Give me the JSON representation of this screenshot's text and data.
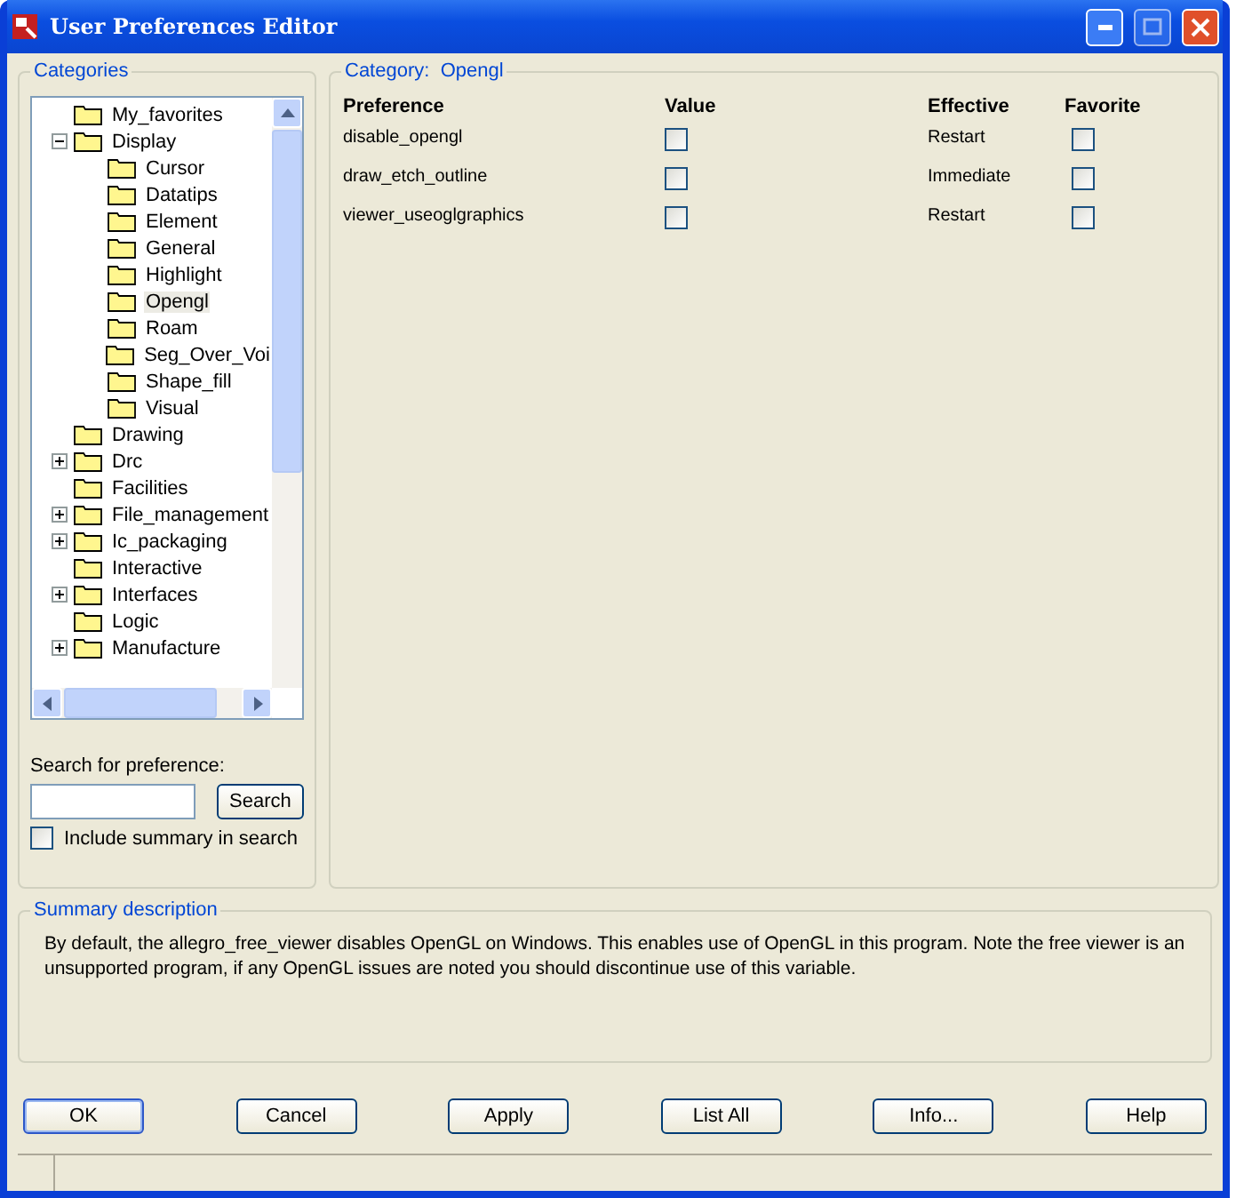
{
  "window": {
    "title": "User Preferences Editor"
  },
  "categories": {
    "title": "Categories",
    "tree": [
      {
        "label": "My_favorites",
        "selected": false
      },
      {
        "label": "Display",
        "expanded": true,
        "selected": false,
        "children": [
          {
            "label": "Cursor",
            "selected": false
          },
          {
            "label": "Datatips",
            "selected": false
          },
          {
            "label": "Element",
            "selected": false
          },
          {
            "label": "General",
            "selected": false
          },
          {
            "label": "Highlight",
            "selected": false
          },
          {
            "label": "Opengl",
            "selected": true
          },
          {
            "label": "Roam",
            "selected": false
          },
          {
            "label": "Seg_Over_Voi",
            "selected": false
          },
          {
            "label": "Shape_fill",
            "selected": false
          },
          {
            "label": "Visual",
            "selected": false
          }
        ]
      },
      {
        "label": "Drawing",
        "selected": false
      },
      {
        "label": "Drc",
        "expanded": false,
        "selected": false
      },
      {
        "label": "Facilities",
        "selected": false
      },
      {
        "label": "File_management",
        "expanded": false,
        "selected": false
      },
      {
        "label": "Ic_packaging",
        "expanded": false,
        "selected": false
      },
      {
        "label": "Interactive",
        "selected": false
      },
      {
        "label": "Interfaces",
        "expanded": false,
        "selected": false
      },
      {
        "label": "Logic",
        "selected": false
      },
      {
        "label": "Manufacture",
        "expanded": false,
        "selected": false
      }
    ],
    "search_label": "Search for preference:",
    "search_button": "Search",
    "include_summary": {
      "label": "Include summary in search",
      "checked": false
    }
  },
  "category": {
    "title_label": "Category:",
    "title_value": "Opengl",
    "columns": [
      "Preference",
      "Value",
      "Effective",
      "Favorite"
    ],
    "rows": [
      {
        "name": "disable_opengl",
        "value": false,
        "effective": "Restart",
        "favorite": false
      },
      {
        "name": "draw_etch_outline",
        "value": false,
        "effective": "Immediate",
        "favorite": false
      },
      {
        "name": "viewer_useoglgraphics",
        "value": false,
        "effective": "Restart",
        "favorite": false
      }
    ]
  },
  "summary": {
    "title": "Summary description",
    "text": "By default, the allegro_free_viewer disables OpenGL on Windows. This enables use of OpenGL in this program. Note the free viewer is an unsupported program, if any OpenGL issues are noted you should discontinue use of this variable."
  },
  "buttons": [
    {
      "label": "OK",
      "default": true
    },
    {
      "label": "Cancel",
      "default": false
    },
    {
      "label": "Apply",
      "default": false
    },
    {
      "label": "List All",
      "default": false
    },
    {
      "label": "Info...",
      "default": false
    },
    {
      "label": "Help",
      "default": false
    }
  ]
}
